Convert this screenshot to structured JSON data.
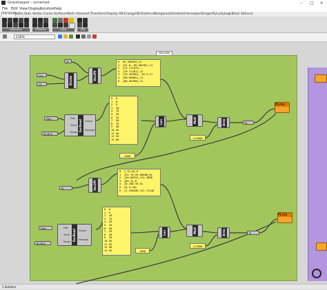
{
  "window": {
    "title": "Grasshopper - unnamed",
    "minimize": "–",
    "maximize": "□",
    "close": "×"
  },
  "menu": [
    "File",
    "Edit",
    "View",
    "Display",
    "Solution",
    "Help"
  ],
  "tabs": [
    "Params",
    "Maths",
    "Sets",
    "Vector",
    "Curve",
    "Surface",
    "Mesh",
    "Intersect",
    "Transform",
    "Display",
    "HB-Energy",
    "HB-Radiance",
    "Kangaroo2",
    "Ameboid",
    "Honeybee",
    "Dragonfly",
    "Ladybug",
    "LBtool",
    "SbExcel"
  ],
  "ribbon_groups": [
    "Geometry",
    "Primitive",
    "Input",
    "Util"
  ],
  "zoom": "118%",
  "group_label": "Ulbo/Ulbb",
  "panels": {
    "p1": "0  94.590263,21\n1  {51.0,-96.60296],21\n2  {74.712679,--\n3  {79.71287},21\n4  {76.40596},-96.3,21\n5  {96.60882},21\n6  {80.903904,21",
    "p2": "0  0\n1  0\n2  5\n3  10\n4  15\n5  20\n6  25\n7  30\n8  35\n9  40\n10 45\n11 50\n12 55\n13 60",
    "p3": "1000",
    "p4": "1/2000",
    "p5": "0  {-31.0},0\n1  {51.79,59.60000,0}\n2  {26.68913,121.3088\n3  {04.3},0\n4  {0,168.59,0}\n5  {0.5,20}\n6  {7.250846,121.71240",
    "p6": "0  0\n1  5\n2  10\n3  15\n4  20\n5  25\n6  30\n7  35\n8  40\n9  45\n10 50\n11 55\n12 60\n13 65",
    "p7": "1000",
    "p8": "1/2000"
  },
  "components": {
    "cDiv1": "Divide",
    "cVec1": "Vec2Pt",
    "cExcel1": "ExcRead",
    "cLen1": "Len",
    "cMul1": "Mult",
    "cArea1": "Area",
    "cMove1": "Move",
    "cPline1": "PLine",
    "cVec2": "Vec2Pt",
    "cExcel2": "ExcRead",
    "cLen2": "Len",
    "cMul2": "Mult",
    "cArea2": "Area",
    "cMove2": "Move",
    "cPline2": "PLine"
  },
  "params": {
    "crv": "Crv",
    "n": "24",
    "pt1": "Pt",
    "path1": "Path",
    "b1": "B1:B15",
    "pt2": "Pt",
    "path2": "Path",
    "b2": "B1:B15",
    "pt3": "Pt",
    "pt4": "Pt"
  },
  "param_labels": {
    "excel_in": [
      "Path",
      "Sheet",
      "Range"
    ],
    "excel_out": [
      "Output",
      "Message"
    ]
  },
  "status": "1 Solution"
}
